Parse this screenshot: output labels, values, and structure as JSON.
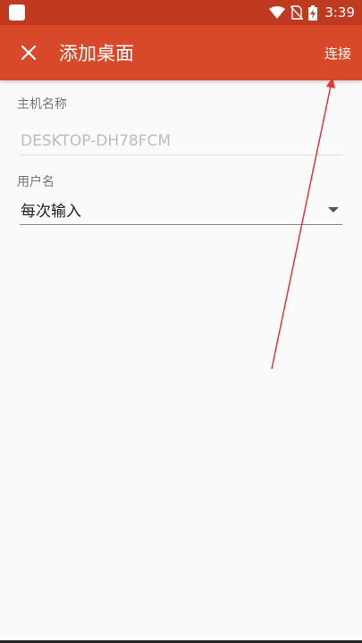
{
  "status_bar": {
    "time": "3:39",
    "icons": [
      "notification-icon",
      "wifi-icon",
      "no-sim-icon",
      "battery-charging-icon"
    ]
  },
  "toolbar": {
    "title": "添加桌面",
    "close_icon": "close-icon",
    "connect_label": "连接"
  },
  "form": {
    "host": {
      "label": "主机名称",
      "value": "",
      "placeholder": "DESKTOP-DH78FCM"
    },
    "username": {
      "label": "用户名",
      "selected": "每次输入",
      "dropdown_icon": "dropdown-arrow-icon"
    }
  },
  "colors": {
    "status_bar": "#bf3a20",
    "toolbar": "#d8492a",
    "annotation_arrow": "#e0383b",
    "background": "#fafafa"
  }
}
